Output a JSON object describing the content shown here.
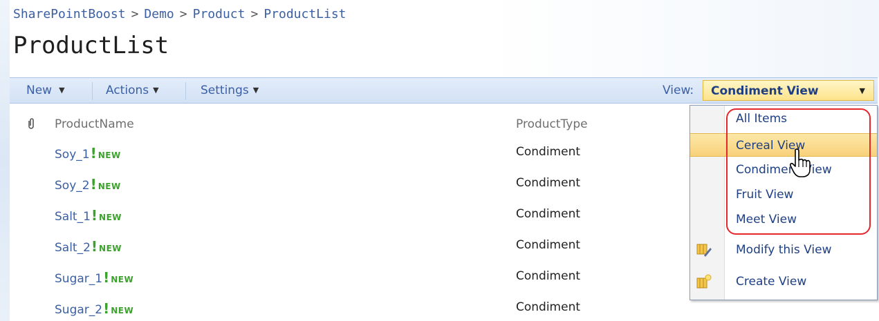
{
  "breadcrumb": [
    "SharePointBoost",
    "Demo",
    "Product",
    "ProductList"
  ],
  "breadcrumb_separator": ">",
  "page_title": "ProductList",
  "toolbar": {
    "new_label": "New",
    "actions_label": "Actions",
    "settings_label": "Settings",
    "view_label": "View:",
    "view_selected": "Condiment View"
  },
  "columns": {
    "attachment_icon": "paperclip-icon",
    "name": "ProductName",
    "type": "ProductType"
  },
  "new_tag": "NEW",
  "rows": [
    {
      "name": "Soy_1",
      "type": "Condiment"
    },
    {
      "name": "Soy_2",
      "type": "Condiment"
    },
    {
      "name": "Salt_1",
      "type": "Condiment"
    },
    {
      "name": "Salt_2",
      "type": "Condiment"
    },
    {
      "name": "Sugar_1",
      "type": "Condiment"
    },
    {
      "name": "Sugar_2",
      "type": "Condiment"
    }
  ],
  "view_menu": {
    "items": [
      {
        "label": "All Items"
      },
      {
        "label": "Cereal View",
        "hover": true
      },
      {
        "label": "Condiment View"
      },
      {
        "label": "Fruit View"
      },
      {
        "label": "Meet View"
      },
      {
        "label": "Modify this View",
        "icon": "modify-view-icon"
      },
      {
        "label": "Create View",
        "icon": "create-view-icon"
      }
    ]
  },
  "colors": {
    "link": "#3b5fa3",
    "new_badge": "#3ca22d",
    "highlight_outline": "#e5272c",
    "toolbar": "#d9e6f7",
    "view_select": "#fde38b"
  }
}
